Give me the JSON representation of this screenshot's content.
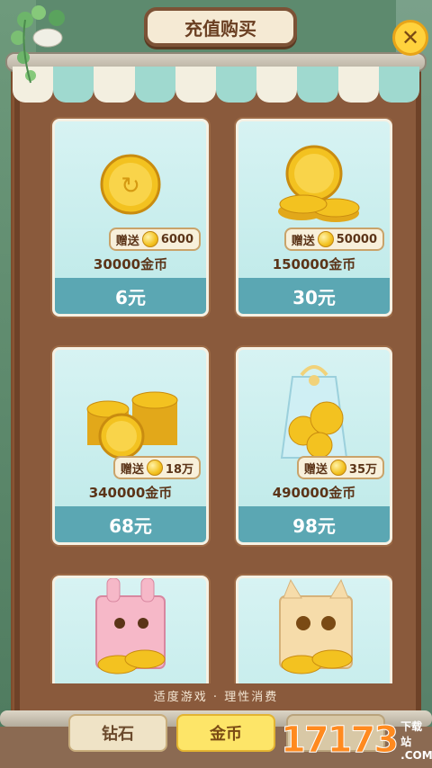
{
  "header": {
    "title": "充值购买",
    "close_label": "✕"
  },
  "cards": [
    {
      "gift_label": "赠送",
      "gift_amount": "6000",
      "amount": "30000金币",
      "price": "6元"
    },
    {
      "gift_label": "赠送",
      "gift_amount": "50000",
      "amount": "150000金币",
      "price": "30元"
    },
    {
      "gift_label": "赠送",
      "gift_amount": "18万",
      "amount": "340000金币",
      "price": "68元"
    },
    {
      "gift_label": "赠送",
      "gift_amount": "35万",
      "amount": "490000金币",
      "price": "98元"
    },
    {
      "gift_label": "",
      "gift_amount": "",
      "amount": "",
      "price": ""
    },
    {
      "gift_label": "",
      "gift_amount": "",
      "amount": "",
      "price": ""
    }
  ],
  "footer": {
    "note": "适度游戏 · 理性消费"
  },
  "tabs": [
    {
      "label": "钻石"
    },
    {
      "label": "金币"
    },
    {
      "label": ""
    }
  ],
  "watermark": {
    "big": "17173",
    "small_top": "下载站",
    "small_bottom": ".COM"
  },
  "colors": {
    "accent": "#5ba7b3",
    "card_bg": "#c8eeee",
    "frame": "#8a5a3c",
    "gold": "#f3c220"
  }
}
